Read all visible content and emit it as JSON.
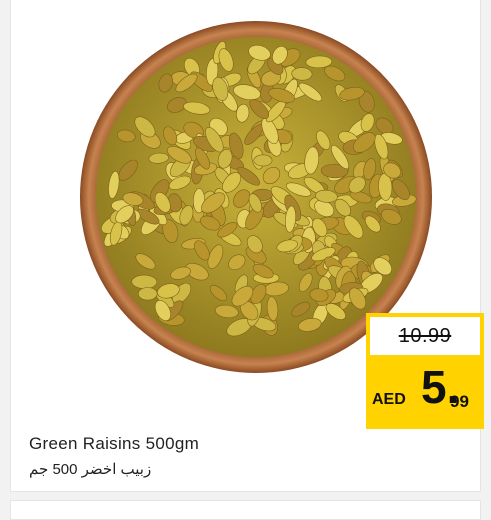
{
  "product": {
    "name_en": "Green Raisins 500gm",
    "name_ar": "زبيب اخضر 500 جم",
    "image_icon": "raisins-bowl-image"
  },
  "price": {
    "old": "10.99",
    "currency": "AED",
    "main": "5.",
    "decimal": "99",
    "badge_color": "#ffd200"
  }
}
